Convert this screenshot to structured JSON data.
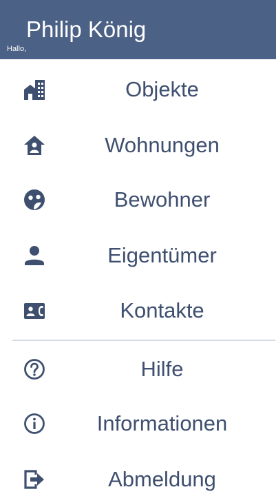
{
  "header": {
    "greeting": "Hallo,",
    "user_name": "Philip König",
    "background_color": "#4b6185"
  },
  "menu": {
    "text_color": "#3e4f6f",
    "icon_color": "#3e4f6f",
    "primary_items": [
      {
        "label": "Objekte",
        "icon": "building-icon"
      },
      {
        "label": "Wohnungen",
        "icon": "home-icon"
      },
      {
        "label": "Bewohner",
        "icon": "face-icon"
      },
      {
        "label": "Eigentümer",
        "icon": "person-icon"
      },
      {
        "label": "Kontakte",
        "icon": "contacts-icon"
      }
    ],
    "secondary_items": [
      {
        "label": "Hilfe",
        "icon": "help-circle-icon"
      },
      {
        "label": "Informationen",
        "icon": "info-circle-icon"
      },
      {
        "label": "Abmeldung",
        "icon": "logout-icon"
      }
    ]
  }
}
